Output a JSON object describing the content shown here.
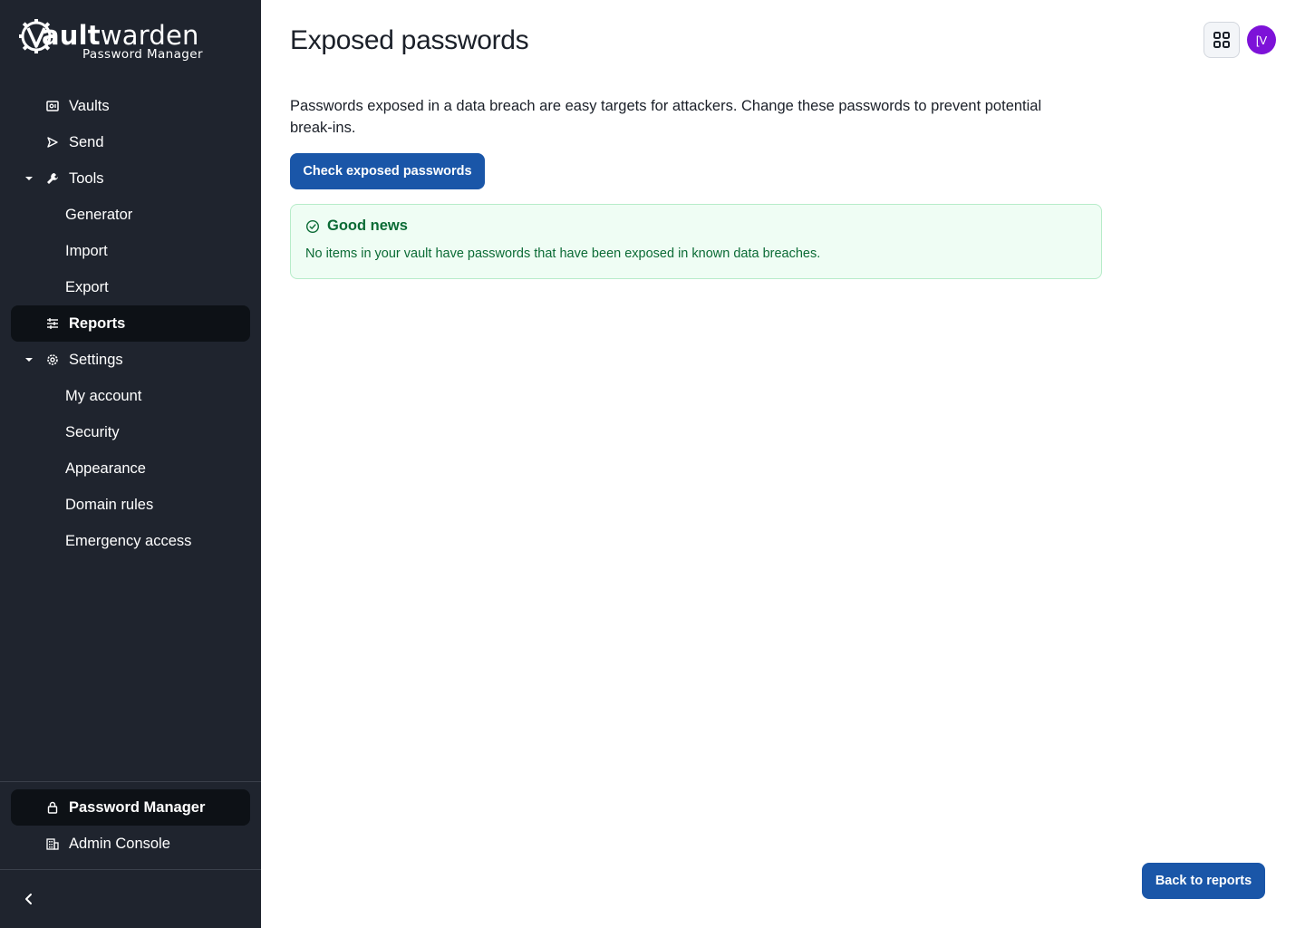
{
  "brand": {
    "name_bold": "V",
    "name_rest_bold": "ault",
    "name_rest": "warden",
    "subtitle": "Password Manager"
  },
  "sidebar": {
    "items": [
      {
        "label": "Vaults",
        "icon": "vault-icon"
      },
      {
        "label": "Send",
        "icon": "send-icon"
      },
      {
        "label": "Tools",
        "icon": "wrench-icon",
        "expanded": true
      },
      {
        "label": "Generator"
      },
      {
        "label": "Import"
      },
      {
        "label": "Export"
      },
      {
        "label": "Reports",
        "icon": "sliders-icon",
        "active": true
      },
      {
        "label": "Settings",
        "icon": "gear-icon",
        "expanded": true
      },
      {
        "label": "My account"
      },
      {
        "label": "Security"
      },
      {
        "label": "Appearance"
      },
      {
        "label": "Domain rules"
      },
      {
        "label": "Emergency access"
      }
    ],
    "products": [
      {
        "label": "Password Manager",
        "icon": "lock-icon",
        "active": true
      },
      {
        "label": "Admin Console",
        "icon": "building-icon"
      }
    ]
  },
  "header": {
    "title": "Exposed passwords",
    "avatar_initials": "[V"
  },
  "main": {
    "description": "Passwords exposed in a data breach are easy targets for attackers. Change these passwords to prevent potential break-ins.",
    "check_button": "Check exposed passwords",
    "callout": {
      "title": "Good news",
      "text": "No items in your vault have passwords that have been exposed in known data breaches."
    },
    "back_button": "Back to reports"
  },
  "colors": {
    "sidebar_bg": "#1f242e",
    "primary": "#1a56a8",
    "success_bg": "#effdf4",
    "success_text": "#0b6b35",
    "avatar": "#7d12d8"
  }
}
